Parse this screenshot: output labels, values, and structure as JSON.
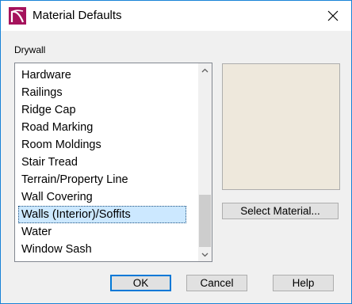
{
  "window": {
    "title": "Material Defaults",
    "close_symbol": "✕",
    "accent_color": "#1883d7"
  },
  "group_label": "Drywall",
  "materials": {
    "items": [
      {
        "label": "Hardware"
      },
      {
        "label": "Railings"
      },
      {
        "label": "Ridge Cap"
      },
      {
        "label": "Road Marking"
      },
      {
        "label": "Room Moldings"
      },
      {
        "label": "Stair Tread"
      },
      {
        "label": "Terrain/Property Line"
      },
      {
        "label": "Wall Covering"
      },
      {
        "label": "Walls (Interior)/Soffits"
      },
      {
        "label": "Water"
      },
      {
        "label": "Window Sash"
      }
    ],
    "selected_index": 8,
    "selected_color": "#cce8ff"
  },
  "preview": {
    "swatch_color": "#eee8dc"
  },
  "buttons": {
    "select_material": "Select Material...",
    "ok": "OK",
    "cancel": "Cancel",
    "help": "Help"
  }
}
